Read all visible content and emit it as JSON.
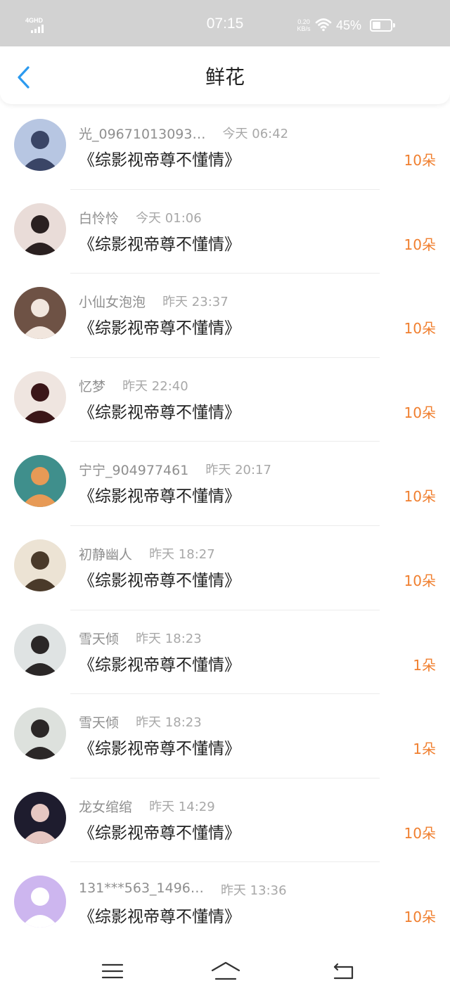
{
  "status_bar": {
    "network": "4GHD",
    "time": "07:15",
    "speed_value": "0.20",
    "speed_unit": "KB/s",
    "battery": "45%",
    "battery_level": 0.45
  },
  "header": {
    "title": "鲜花",
    "back_icon": "chevron-left-icon"
  },
  "items": [
    {
      "name": "光_09671013093…",
      "time": "今天 06:42",
      "book": "《综影视帝尊不懂情》",
      "count": "10朵"
    },
    {
      "name": "白怜怜",
      "time": "今天 01:06",
      "book": "《综影视帝尊不懂情》",
      "count": "10朵"
    },
    {
      "name": "小仙女泡泡",
      "time": "昨天 23:37",
      "book": "《综影视帝尊不懂情》",
      "count": "10朵"
    },
    {
      "name": "忆梦",
      "time": "昨天 22:40",
      "book": "《综影视帝尊不懂情》",
      "count": "10朵"
    },
    {
      "name": "宁宁_904977461",
      "time": "昨天 20:17",
      "book": "《综影视帝尊不懂情》",
      "count": "10朵"
    },
    {
      "name": "初静幽人",
      "time": "昨天 18:27",
      "book": "《综影视帝尊不懂情》",
      "count": "10朵"
    },
    {
      "name": "雪天倾",
      "time": "昨天 18:23",
      "book": "《综影视帝尊不懂情》",
      "count": "1朵"
    },
    {
      "name": "雪天倾",
      "time": "昨天 18:23",
      "book": "《综影视帝尊不懂情》",
      "count": "1朵"
    },
    {
      "name": "龙女绾绾",
      "time": "昨天 14:29",
      "book": "《综影视帝尊不懂情》",
      "count": "10朵"
    },
    {
      "name": "131***563_1496…",
      "time": "昨天 13:36",
      "book": "《综影视帝尊不懂情》",
      "count": "10朵"
    }
  ],
  "avatars": [
    {
      "bg": "#b7c6e2",
      "fg": "#3a4566"
    },
    {
      "bg": "#e9dcd8",
      "fg": "#2a2020"
    },
    {
      "bg": "#6e5245",
      "fg": "#f1e6de"
    },
    {
      "bg": "#efe5e0",
      "fg": "#3a1618"
    },
    {
      "bg": "#3f8f8c",
      "fg": "#e79a56"
    },
    {
      "bg": "#ece3d4",
      "fg": "#4a3a2a"
    },
    {
      "bg": "#dfe3e3",
      "fg": "#2b2727"
    },
    {
      "bg": "#dde1dd",
      "fg": "#2b2727"
    },
    {
      "bg": "#1e1c2e",
      "fg": "#e6c7c2"
    },
    {
      "bg": "#cdb6ef",
      "fg": "#ffffff"
    }
  ],
  "colors": {
    "accent": "#f07f2f",
    "back_icon": "#2c9aef"
  },
  "bottom_nav": [
    "menu-icon",
    "home-icon",
    "back-icon"
  ]
}
